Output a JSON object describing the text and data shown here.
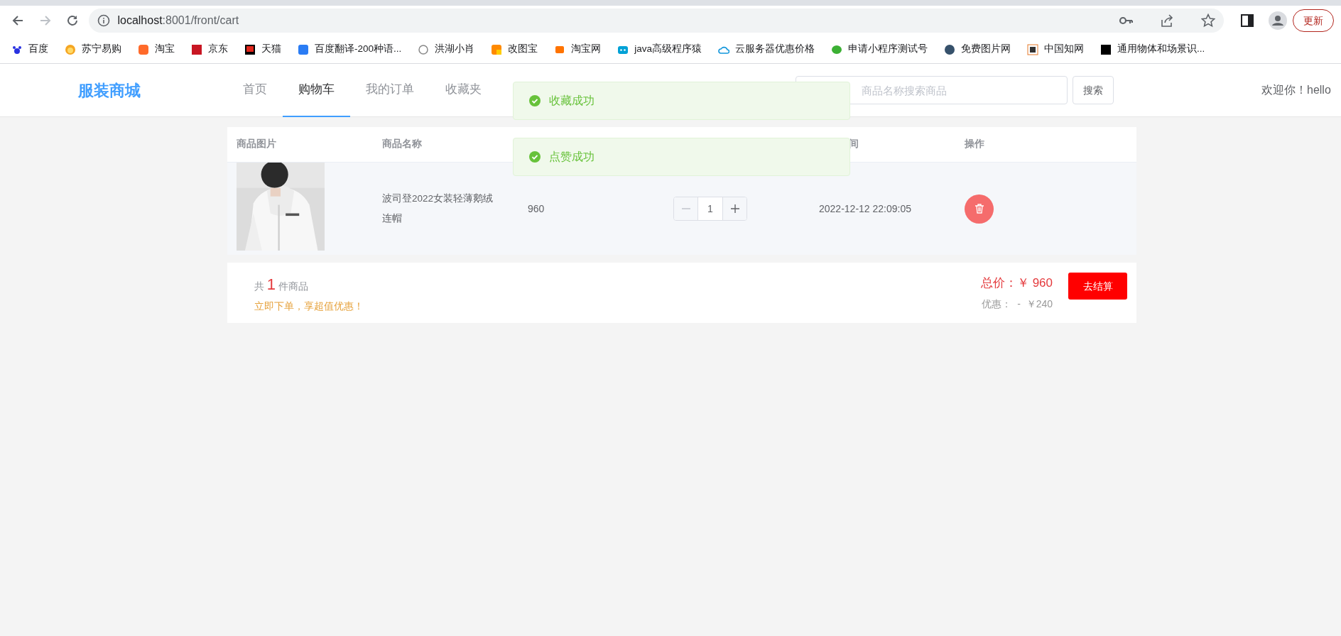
{
  "browser": {
    "url_host": "localhost",
    "url_path": ":8001/front/cart",
    "update_button": "更新",
    "forward_disabled": true
  },
  "bookmarks": [
    {
      "label": "百度"
    },
    {
      "label": "苏宁易购"
    },
    {
      "label": "淘宝"
    },
    {
      "label": "京东"
    },
    {
      "label": "天猫"
    },
    {
      "label": "百度翻译-200种语..."
    },
    {
      "label": "洪湖小肖"
    },
    {
      "label": "改图宝"
    },
    {
      "label": "淘宝网"
    },
    {
      "label": "java高级程序猿"
    },
    {
      "label": "云服务器优惠价格"
    },
    {
      "label": "申请小程序测试号"
    },
    {
      "label": "免费图片网"
    },
    {
      "label": "中国知网"
    },
    {
      "label": "通用物体和场景识..."
    }
  ],
  "header": {
    "logo": "服装商城",
    "nav": [
      {
        "label": "首页",
        "selected": false
      },
      {
        "label": "购物车",
        "selected": true
      },
      {
        "label": "我的订单",
        "selected": false
      },
      {
        "label": "收藏夹",
        "selected": false
      }
    ],
    "search": {
      "placeholder": "商品名称搜索商品",
      "button": "搜索"
    },
    "welcome": "欢迎你！hello"
  },
  "toasts": [
    {
      "text": "收藏成功"
    },
    {
      "text": "点赞成功"
    }
  ],
  "cart_table": {
    "columns": {
      "image": "商品图片",
      "name": "商品名称",
      "column_5": "间",
      "action": "操作"
    },
    "rows": [
      {
        "name": "波司登2022女装轻薄鹅绒连帽",
        "price": "960",
        "quantity": "1",
        "time": "2022-12-12 22:09:05"
      }
    ]
  },
  "summary": {
    "count_prefix": "共",
    "count": "1",
    "count_suffix": "件商品",
    "promo": "立即下单，享超值优惠！",
    "total": "总价：￥ 960",
    "discount": "优惠：  -  ￥240",
    "checkout_button": "去结算"
  }
}
